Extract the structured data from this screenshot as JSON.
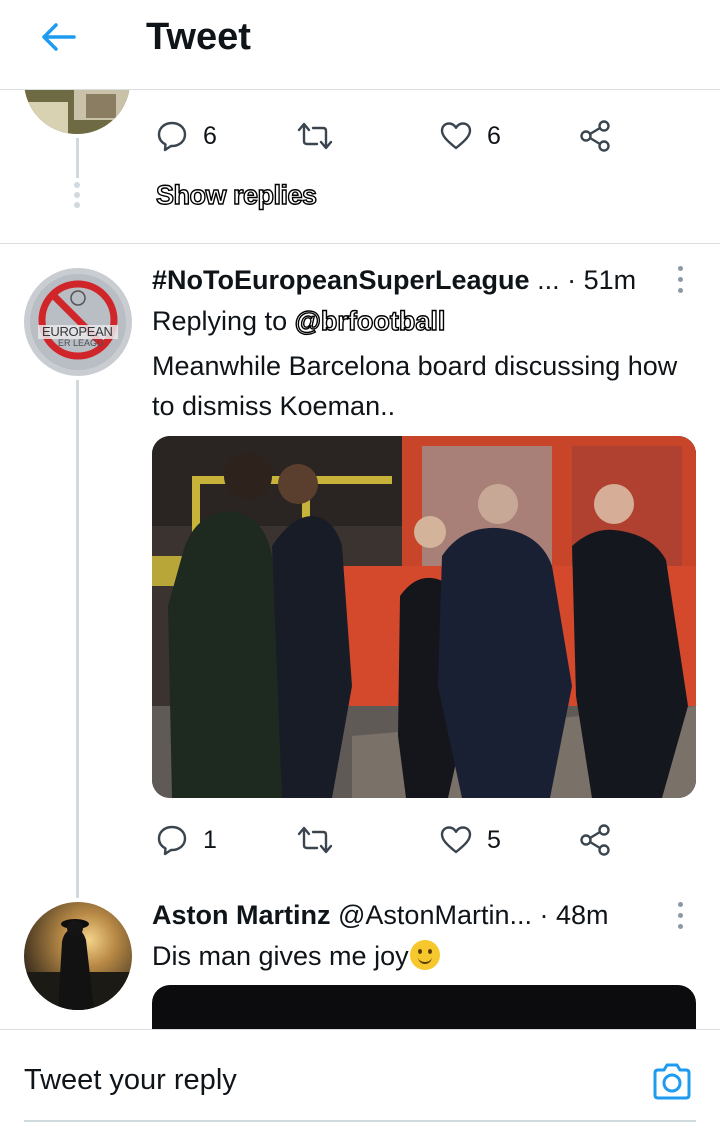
{
  "header": {
    "title": "Tweet"
  },
  "prev_tweet": {
    "reply_count": "6",
    "like_count": "6",
    "show_replies_label": "Show replies"
  },
  "tweet1": {
    "display_name": "#NoToEuropeanSuperLeague",
    "handle_ellipsis": "...",
    "time": "· 51m",
    "replying_prefix": "Replying to",
    "replying_handle": "@brfootball",
    "text": "Meanwhile Barcelona board discussing how to dismiss Koeman..",
    "reply_count": "1",
    "like_count": "5",
    "avatar_text_top": "EUROPEAN",
    "avatar_text_bottom": "ER LEAGU"
  },
  "tweet2": {
    "display_name": "Aston Martinz",
    "handle": "@AstonMartin...",
    "time": "· 48m",
    "text": "Dis man gives me joy"
  },
  "reply_bar": {
    "placeholder": "Tweet your reply"
  },
  "colors": {
    "accent": "#1d9bf0",
    "thread_line": "#cfd9de",
    "divider": "#d9dee2"
  },
  "icons": [
    "back-arrow-icon",
    "reply-icon",
    "retweet-icon",
    "like-icon",
    "share-icon",
    "more-vertical-icon",
    "camera-icon"
  ]
}
